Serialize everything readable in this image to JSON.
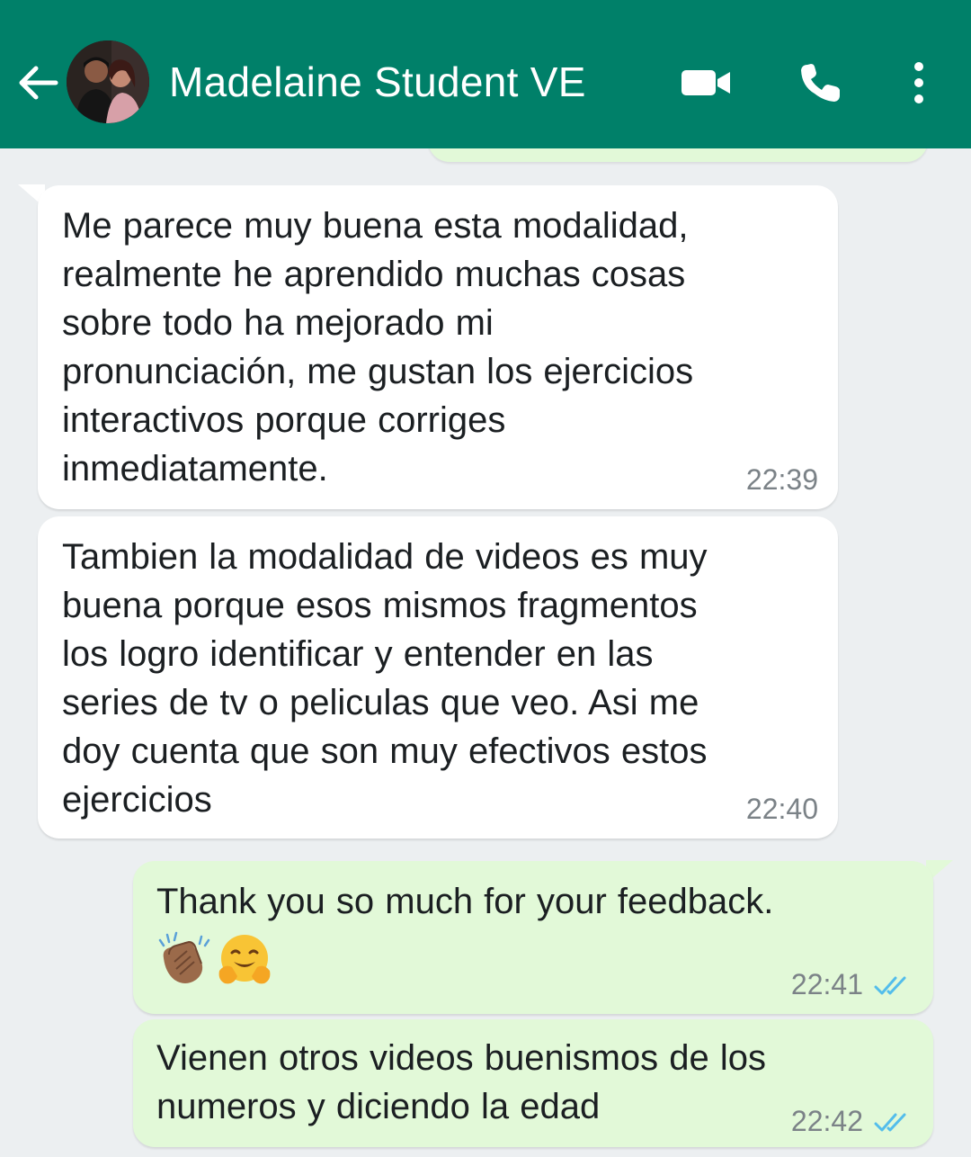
{
  "header": {
    "title": "Madelaine Student VE",
    "back_icon": "arrow-back-icon",
    "avatar": "contact-avatar",
    "actions": [
      "video-call-icon",
      "voice-call-icon",
      "more-vert-icon"
    ],
    "color": "#008069"
  },
  "messages": [
    {
      "direction": "incoming",
      "text": "Me parece muy buena esta modalidad,\nrealmente he aprendido muchas cosas\nsobre todo ha mejorado mi\npronunciación, me gustan los ejercicios\ninteractivos porque  corriges\ninmediatamente.",
      "time": "22:39"
    },
    {
      "direction": "incoming",
      "text": "Tambien la modalidad de videos es muy\nbuena porque esos mismos fragmentos\nlos logro identificar y entender en las\nseries de tv o peliculas que veo. Asi me\ndoy cuenta que son muy efectivos estos\nejercicios",
      "time": "22:40"
    },
    {
      "direction": "outgoing",
      "text": "Thank you so much for your feedback.",
      "emojis": [
        "clapping-hands-emoji",
        "hugging-face-emoji"
      ],
      "time": "22:41",
      "status": "read-ticks-icon"
    },
    {
      "direction": "outgoing",
      "text": "Vienen otros videos buenismos de los\nnumeros y diciendo la edad",
      "time": "22:42",
      "status": "read-ticks-icon"
    }
  ],
  "colors": {
    "incoming_bubble": "#ffffff",
    "outgoing_bubble": "#e2f9d8",
    "read_ticks": "#53bdeb",
    "chat_background": "#eceff1"
  }
}
